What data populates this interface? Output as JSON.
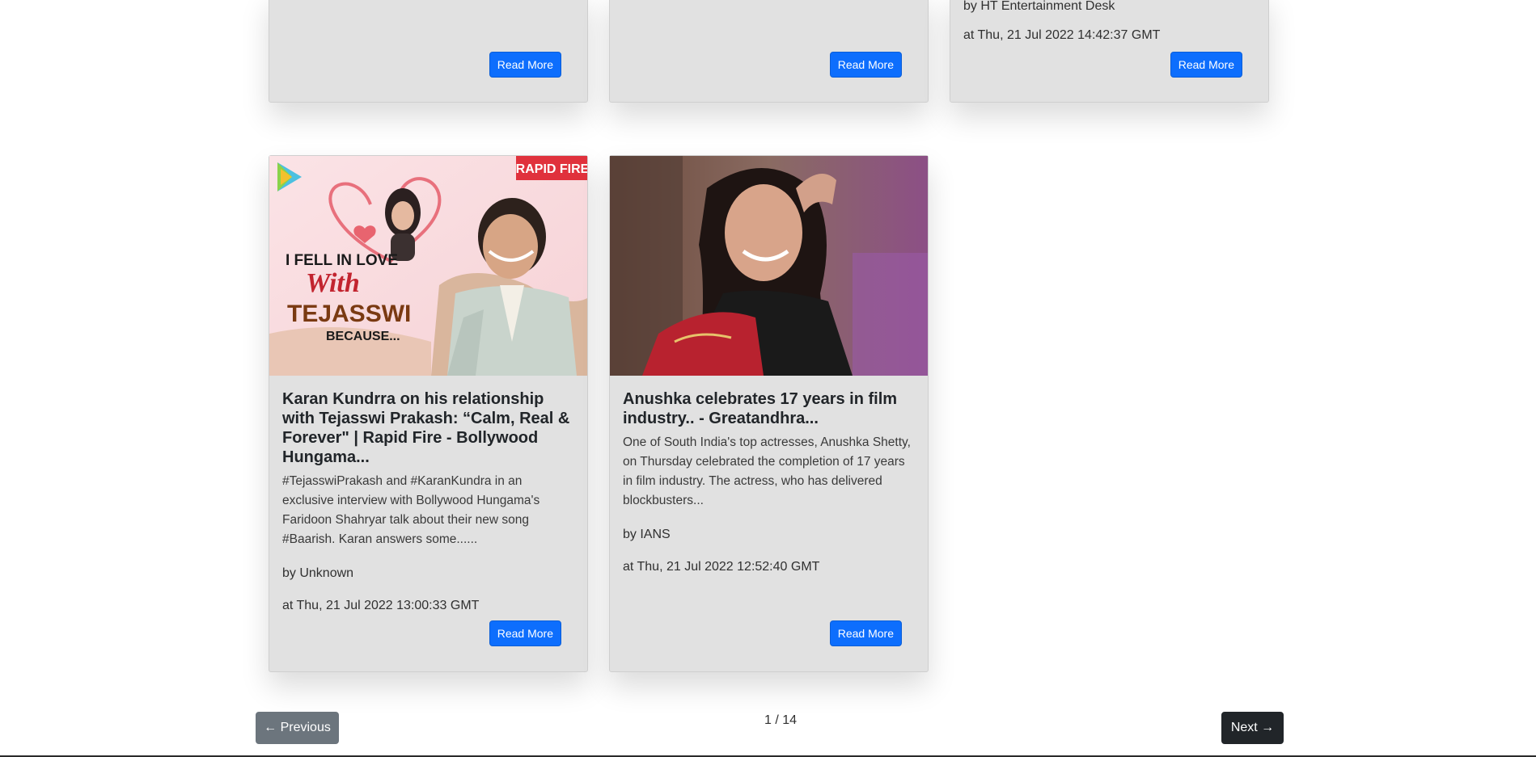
{
  "top_cards": [
    {
      "author": "",
      "date": "",
      "read_more": "Read More"
    },
    {
      "author": "",
      "date": "",
      "read_more": "Read More"
    },
    {
      "author": "by HT Entertainment Desk",
      "date": "at Thu, 21 Jul 2022 14:42:37 GMT",
      "read_more": "Read More"
    }
  ],
  "cards": [
    {
      "title": "Karan Kundrra on his relationship with Tejasswi Prakash: “Calm, Real & Forever\" | Rapid Fire - Bollywood Hungama...",
      "description": "#TejasswiPrakash and #KaranKundra in an exclusive interview with Bollywood Hungama's Faridoon Shahryar talk about their new song #Baarish. Karan answers some......",
      "author": "by Unknown",
      "date": "at Thu, 21 Jul 2022 13:00:33 GMT",
      "read_more": "Read More",
      "image": {
        "badge": "RAPID FIRE",
        "line1": "I FELL IN LOVE",
        "line2": "With",
        "line3": "TEJASSWI",
        "line4": "BECAUSE..."
      }
    },
    {
      "title": "Anushka celebrates 17 years in film industry.. - Greatandhra...",
      "description": "One of South India's top actresses, Anushka Shetty, on Thursday celebrated the completion of 17 years in film industry. The actress, who has delivered blockbusters...",
      "author": "by IANS",
      "date": "at Thu, 21 Jul 2022 12:52:40 GMT",
      "read_more": "Read More"
    }
  ],
  "pagination": {
    "previous": "← Previous",
    "indicator": "1 / 14",
    "next": "Next →"
  },
  "colors": {
    "primary_button": "#0d6efd",
    "previous_button": "#6c757d",
    "next_button": "#212529",
    "card_background": "#e1e1e1"
  }
}
